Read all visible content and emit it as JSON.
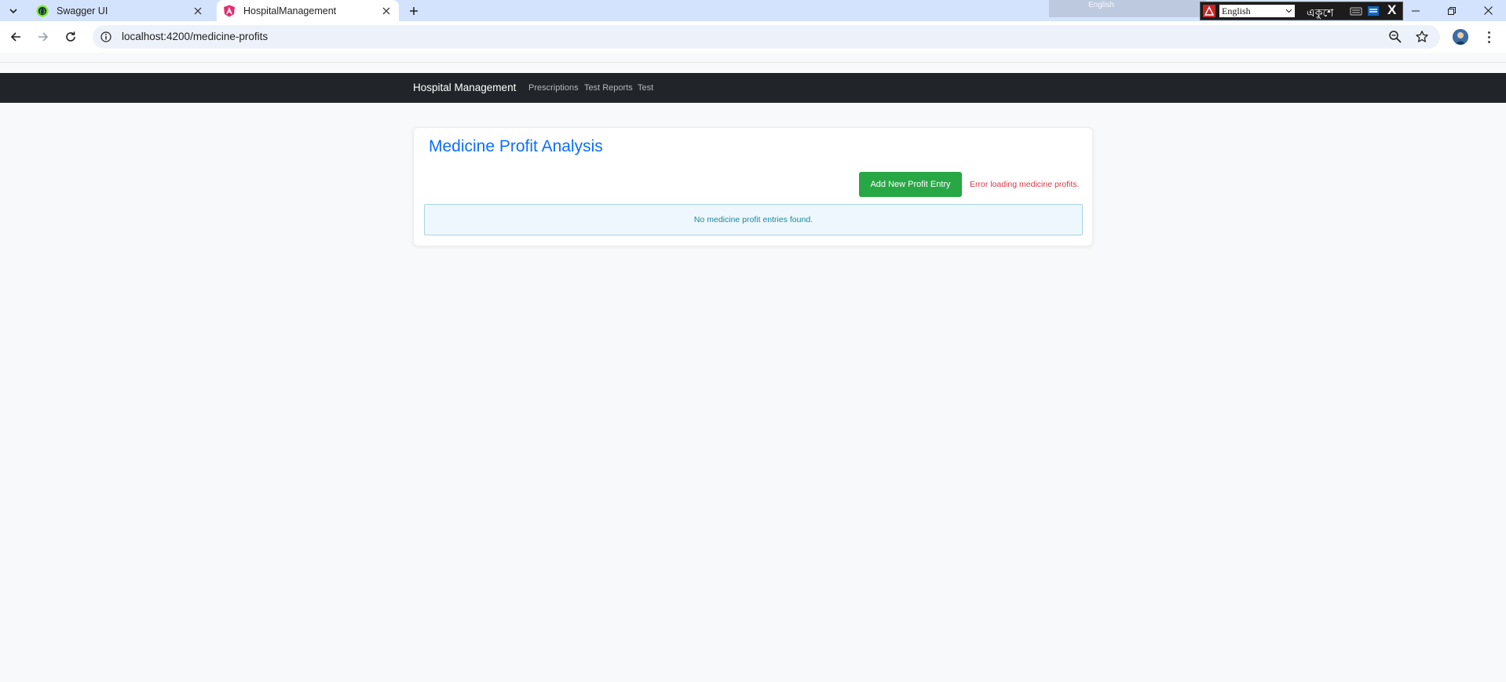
{
  "browser": {
    "tabs": [
      {
        "title": "Swagger UI",
        "active": false
      },
      {
        "title": "HospitalManagement",
        "active": true
      }
    ],
    "url": "localhost:4200/medicine-profits",
    "ime": {
      "language_label": "English",
      "language_selected": "English",
      "bangla_text": "একুশে",
      "close_label": "X"
    }
  },
  "app": {
    "brand": "Hospital Management",
    "nav": [
      "Prescriptions",
      "Test Reports",
      "Test"
    ]
  },
  "page": {
    "title": "Medicine Profit Analysis",
    "add_button": "Add New Profit Entry",
    "error": "Error loading medicine profits.",
    "empty_message": "No medicine profit entries found."
  },
  "colors": {
    "primary": "#0d6efd",
    "success": "#28a745",
    "danger": "#dc3545",
    "info_text": "#17899f",
    "navbar": "#212529"
  }
}
